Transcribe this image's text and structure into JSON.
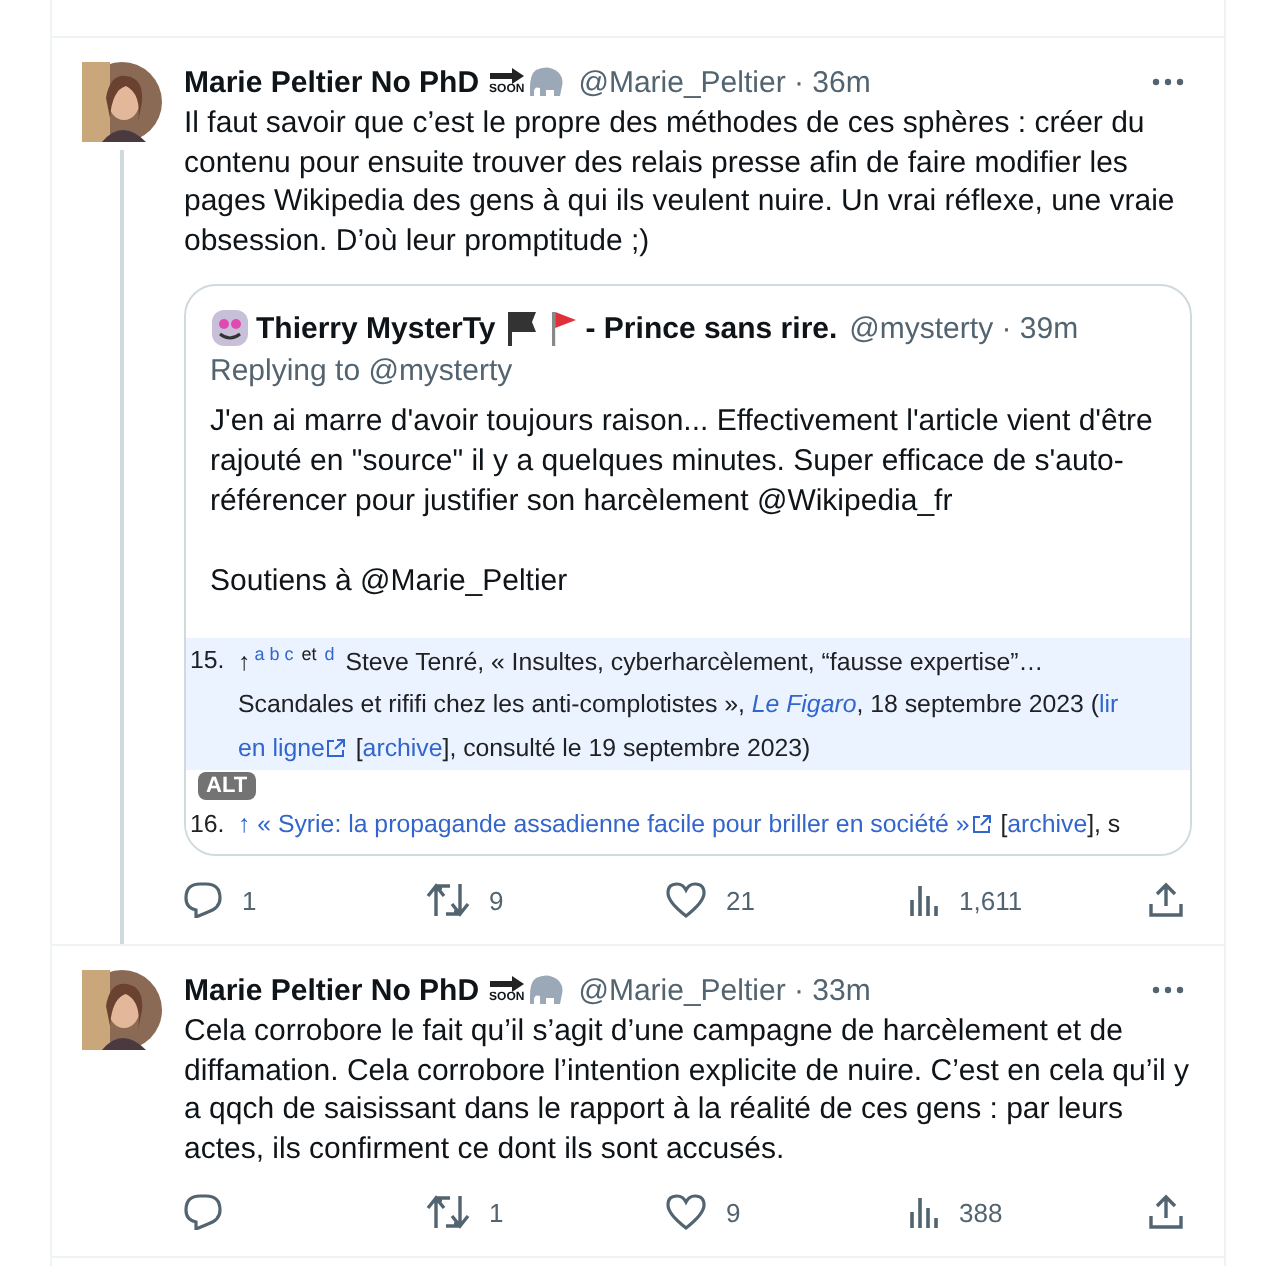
{
  "tweets": [
    {
      "name": "Marie Peltier No PhD",
      "badge_text": "SOON",
      "meta": "@Marie_Peltier · 36m",
      "thread_line": true,
      "text": "Il faut savoir que c’est le propre des méthodes de ces sphères : créer du contenu pour ensuite trouver des relais presse afin de faire modifier les pages Wikipedia des gens à qui ils veulent nuire. Un vrai réflexe, une vraie obsession. D’où leur promptitude ;)",
      "quote": {
        "name": "Thierry MysterTy",
        "name_suffix": "- Prince sans rire.",
        "meta": "@mysterty · 39m",
        "replying": "Replying to @mysterty",
        "paragraphs": [
          "J'en ai marre d'avoir toujours raison... Effectivement l'article vient d'être rajouté en \"source\" il y a quelques minutes. Super efficace de s'auto-référencer pour justifier son harcèlement @Wikipedia_fr",
          "Soutiens à @Marie_Peltier"
        ],
        "image": {
          "alt_badge": "ALT",
          "lines": [
            {
              "highlighted": true,
              "number": "15.",
              "segments": [
                {
                  "text": "↑",
                  "kind": "plain"
                },
                {
                  "text": "a b c",
                  "kind": "sup-link"
                },
                {
                  "text": "et",
                  "kind": "sup"
                },
                {
                  "text": "d",
                  "kind": "sup-link"
                },
                {
                  "text": " Steve Tenré, « Insultes, cyberharcèlement, “fausse expertise”…",
                  "kind": "plain"
                }
              ]
            },
            {
              "highlighted": true,
              "segments": [
                {
                  "text": "Scandales et rififi chez les anti-complotistes », ",
                  "kind": "plain"
                },
                {
                  "text": "Le Figaro",
                  "kind": "italic-link"
                },
                {
                  "text": ", 18 septembre 2023 (",
                  "kind": "plain"
                },
                {
                  "text": "lir",
                  "kind": "link"
                }
              ]
            },
            {
              "highlighted": true,
              "segments": [
                {
                  "text": "en ligne",
                  "kind": "external"
                },
                {
                  "text": " [",
                  "kind": "plain"
                },
                {
                  "text": "archive",
                  "kind": "link"
                },
                {
                  "text": "], consulté le 19 septembre 2023)",
                  "kind": "plain"
                }
              ]
            },
            {
              "highlighted": false,
              "number": "16.",
              "segments": [
                {
                  "text": "↑ « Syrie: la propagande assadienne facile pour briller en société »",
                  "kind": "external"
                },
                {
                  "text": " [",
                  "kind": "plain"
                },
                {
                  "text": "archive",
                  "kind": "link"
                },
                {
                  "text": "], s",
                  "kind": "plain"
                }
              ]
            }
          ]
        }
      },
      "actions": [
        {
          "kind": "reply",
          "count": "1"
        },
        {
          "kind": "retweet",
          "count": "9"
        },
        {
          "kind": "like",
          "count": "21"
        },
        {
          "kind": "views",
          "count": "1,611"
        },
        {
          "kind": "share"
        }
      ]
    },
    {
      "name": "Marie Peltier No PhD",
      "badge_text": "SOON",
      "meta": "@Marie_Peltier · 33m",
      "thread_line": false,
      "text": "Cela corrobore le fait qu’il s’agit d’une campagne de harcèlement et de diffamation. Cela corrobore l’intention explicite de nuire. C’est en cela qu’il y a qqch de saisissant dans le rapport à la réalité de ces gens : par leurs actes, ils confirment ce dont ils sont accusés.",
      "actions": [
        {
          "kind": "reply"
        },
        {
          "kind": "retweet",
          "count": "1"
        },
        {
          "kind": "like",
          "count": "9"
        },
        {
          "kind": "views",
          "count": "388"
        },
        {
          "kind": "share"
        }
      ]
    }
  ]
}
